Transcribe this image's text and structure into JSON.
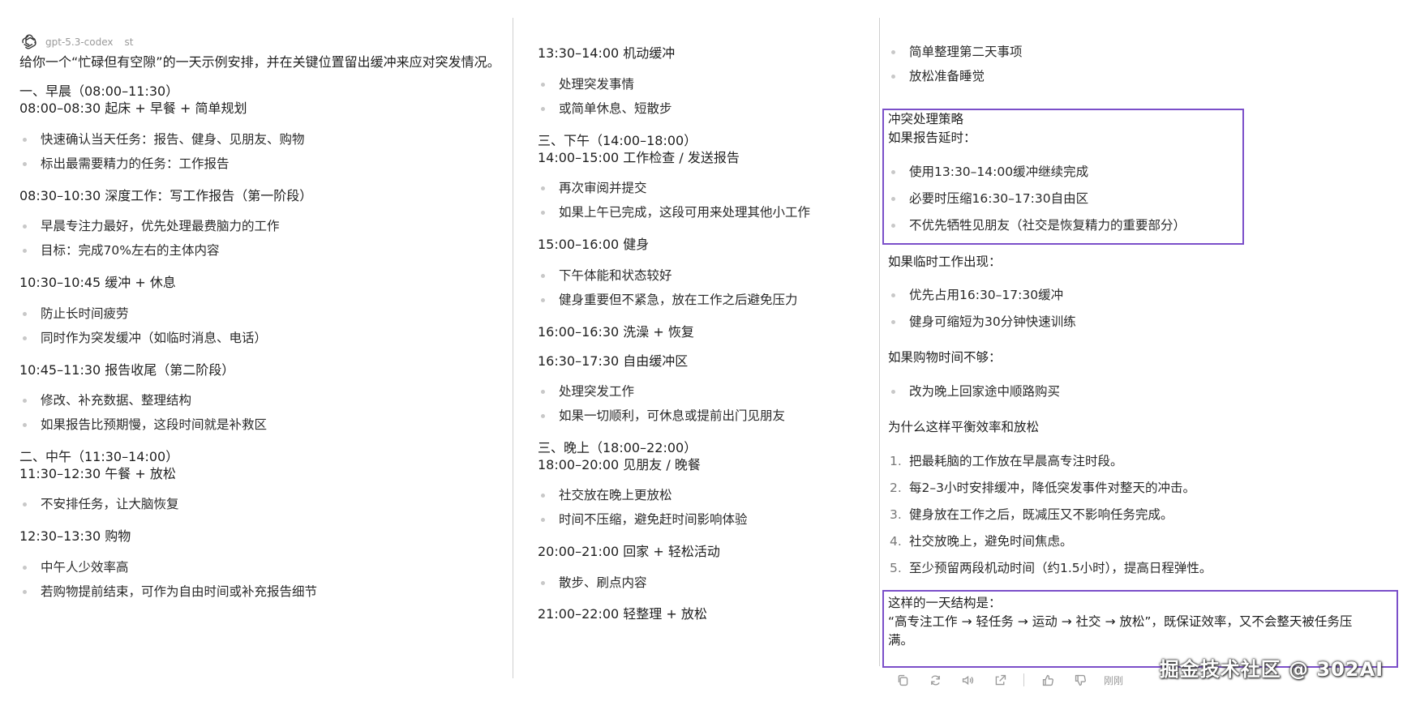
{
  "model": {
    "name": "gpt-5.3-codex",
    "tag": "st"
  },
  "col1": {
    "intro": "给你一个“忙碌但有空隙”的一天示例安排，并在关键位置留出缓冲来应对突发情况。",
    "morning_heading": "一、早晨（08:00–11:30）",
    "slot1": "08:00–08:30 起床 + 早餐 + 简单规划",
    "slot1_items": [
      "快速确认当天任务：报告、健身、见朋友、购物",
      "标出最需要精力的任务：工作报告"
    ],
    "slot2": "08:30–10:30 深度工作：写工作报告（第一阶段）",
    "slot2_items": [
      "早晨专注力最好，优先处理最费脑力的工作",
      "目标：完成70%左右的主体内容"
    ],
    "slot3": "10:30–10:45 缓冲 + 休息",
    "slot3_items": [
      "防止长时间疲劳",
      "同时作为突发缓冲（如临时消息、电话）"
    ],
    "slot4": "10:45–11:30 报告收尾（第二阶段）",
    "slot4_items": [
      "修改、补充数据、整理结构",
      "如果报告比预期慢，这段时间就是补救区"
    ],
    "noon_heading": "二、中午（11:30–14:00）",
    "slot5": "11:30–12:30 午餐 + 放松",
    "slot5_items": [
      "不安排任务，让大脑恢复"
    ],
    "slot6": "12:30–13:30 购物",
    "slot6_items": [
      "中午人少效率高",
      "若购物提前结束，可作为自由时间或补充报告细节"
    ]
  },
  "col2": {
    "slot7": "13:30–14:00 机动缓冲",
    "slot7_items": [
      "处理突发事情",
      "或简单休息、短散步"
    ],
    "afternoon_heading": "三、下午（14:00–18:00）",
    "slot8": "14:00–15:00 工作检查 / 发送报告",
    "slot8_items": [
      "再次审阅并提交",
      "如果上午已完成，这段可用来处理其他小工作"
    ],
    "slot9": "15:00–16:00 健身",
    "slot9_items": [
      "下午体能和状态较好",
      "健身重要但不紧急，放在工作之后避免压力"
    ],
    "slot10": "16:00–16:30 洗澡 + 恢复",
    "slot11": "16:30–17:30 自由缓冲区",
    "slot11_items": [
      "处理突发工作",
      "如果一切顺利，可休息或提前出门见朋友"
    ],
    "evening_heading": "三、晚上（18:00–22:00）",
    "slot12": "18:00–20:00 见朋友 / 晚餐",
    "slot12_items": [
      "社交放在晚上更放松",
      "时间不压缩，避免赶时间影响体验"
    ],
    "slot13": "20:00–21:00 回家 + 轻松活动",
    "slot13_items": [
      "散步、刷点内容"
    ],
    "slot14": "21:00–22:00 轻整理 + 放松"
  },
  "col3": {
    "top_items": [
      "简单整理第二天事项",
      "放松准备睡觉"
    ],
    "conflict_heading": "冲突处理策略",
    "if_report": "如果报告延时：",
    "report_items": [
      "使用13:30–14:00缓冲继续完成",
      "必要时压缩16:30–17:30自由区",
      "不优先牺牲见朋友（社交是恢复精力的重要部分）"
    ],
    "if_work": "如果临时工作出现：",
    "work_items": [
      "优先占用16:30–17:30缓冲",
      "健身可缩短为30分钟快速训练"
    ],
    "if_shopping": "如果购物时间不够：",
    "shopping_items": [
      "改为晚上回家途中顺路购买"
    ],
    "why_heading": "为什么这样平衡效率和放松",
    "why_items": [
      "把最耗脑的工作放在早晨高专注时段。",
      "每2–3小时安排缓冲，降低突发事件对整天的冲击。",
      "健身放在工作之后，既减压又不影响任务完成。",
      "社交放晚上，避免时间焦虑。",
      "至少预留两段机动时间（约1.5小时），提高日程弹性。"
    ],
    "summary_1": "这样的一天结构是：",
    "summary_2": "“高专注工作 → 轻任务 → 运动 → 社交 → 放松”，既保证效率，又不会整天被任务压",
    "summary_3": "满。"
  },
  "toolbar": {
    "time": "刚刚"
  },
  "watermark": "掘金技术社区 @ 302AI",
  "colors": {
    "highlight": "#7b4fc9",
    "bullet": "#c8c8c8"
  }
}
